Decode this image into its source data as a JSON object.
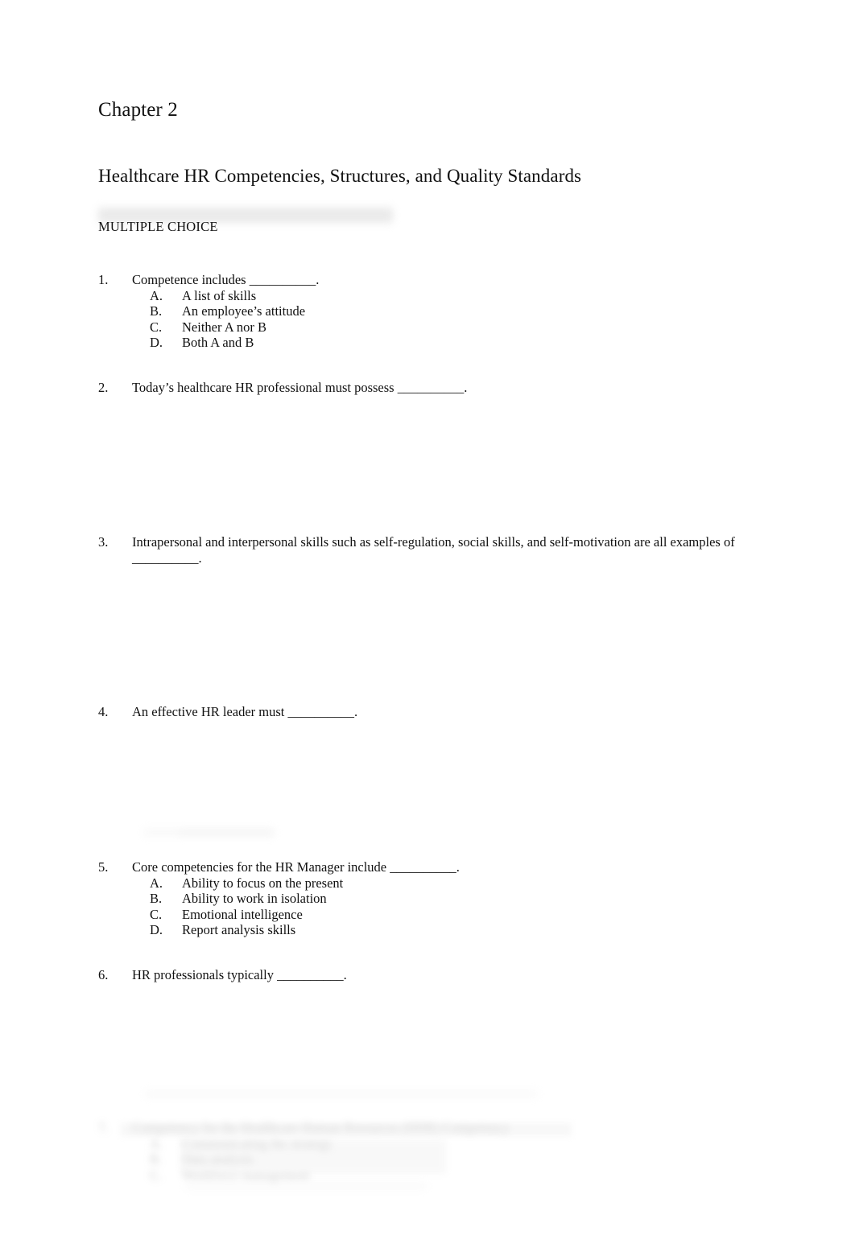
{
  "document": {
    "chapter_title": "Chapter 2",
    "subtitle": "Healthcare HR Competencies, Structures, and Quality Standards",
    "section_label": "MULTIPLE CHOICE"
  },
  "questions": [
    {
      "number": "1.",
      "text": "Competence includes __________.",
      "options": [
        {
          "letter": "A.",
          "text": "A list of skills"
        },
        {
          "letter": "B.",
          "text": "An employee’s attitude"
        },
        {
          "letter": "C.",
          "text": "Neither A nor B"
        },
        {
          "letter": "D.",
          "text": "Both A and B"
        }
      ]
    },
    {
      "number": "2.",
      "text": "Today’s healthcare HR professional must possess __________.",
      "options": []
    },
    {
      "number": "3.",
      "text": "Intrapersonal and interpersonal skills such as self-regulation, social skills, and self-motivation are all examples of __________.",
      "options": []
    },
    {
      "number": "4.",
      "text": "An effective HR leader must __________.",
      "options": []
    },
    {
      "number": "5.",
      "text": "Core competencies for the HR Manager include __________.",
      "options": [
        {
          "letter": "A.",
          "text": "Ability to focus on the present"
        },
        {
          "letter": "B.",
          "text": "Ability to work in isolation"
        },
        {
          "letter": "C.",
          "text": "Emotional intelligence"
        },
        {
          "letter": "D.",
          "text": "Report analysis skills"
        }
      ]
    },
    {
      "number": "6.",
      "text": "HR professionals typically __________.",
      "options": []
    }
  ],
  "obscured_question": {
    "number": "7.",
    "text": "Competency for the Healthcare Human Resources (HHR) Competency",
    "options": [
      {
        "letter": "A.",
        "text": "Communicating the strategy"
      },
      {
        "letter": "B.",
        "text": "Data analysis"
      },
      {
        "letter": "C.",
        "text": "Workforce management"
      }
    ],
    "legibility": "illegible"
  }
}
